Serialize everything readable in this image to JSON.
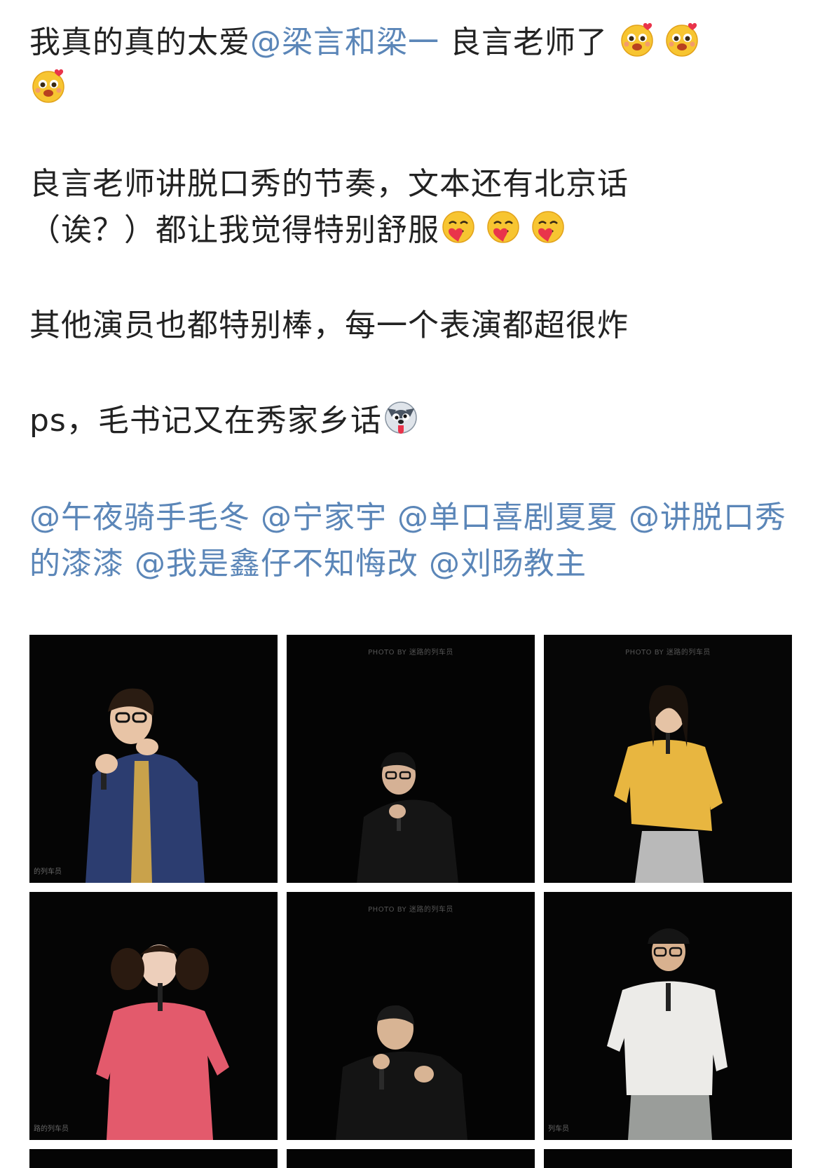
{
  "post": {
    "line1_pre": "我真的真的太爱",
    "line1_mention": "@梁言和梁一",
    "line1_post": " 良言老师了",
    "para2_line1": "良言老师讲脱口秀的节奏，文本还有北京话",
    "para2_line2": "（诶？）都让我觉得特别舒服",
    "para3": "其他演员也都特别棒，每一个表演都超很炸",
    "para4": "ps，毛书记又在秀家乡话",
    "mentions": [
      "@午夜骑手毛冬",
      "@宁家宇",
      "@单口喜剧夏夏",
      "@讲脱口秀的漆漆",
      "@我是鑫仔不知悔改",
      "@刘旸教主"
    ]
  },
  "emojis": {
    "love_struck": "love-face-icon",
    "hug": "hug-face-icon",
    "dog": "silly-dog-icon"
  },
  "photos": [
    {
      "watermark_top": "",
      "watermark_left": "的列车员"
    },
    {
      "watermark_top": "PHOTO BY 迷路的列车员",
      "watermark_left": ""
    },
    {
      "watermark_top": "PHOTO BY 迷路的列车员",
      "watermark_left": ""
    },
    {
      "watermark_top": "",
      "watermark_left": "路的列车员"
    },
    {
      "watermark_top": "PHOTO BY 迷路的列车员",
      "watermark_left": ""
    },
    {
      "watermark_top": "",
      "watermark_left": "列车员"
    }
  ],
  "colors": {
    "mention": "#5b86b8",
    "text": "#222222",
    "stage": "#050505"
  }
}
